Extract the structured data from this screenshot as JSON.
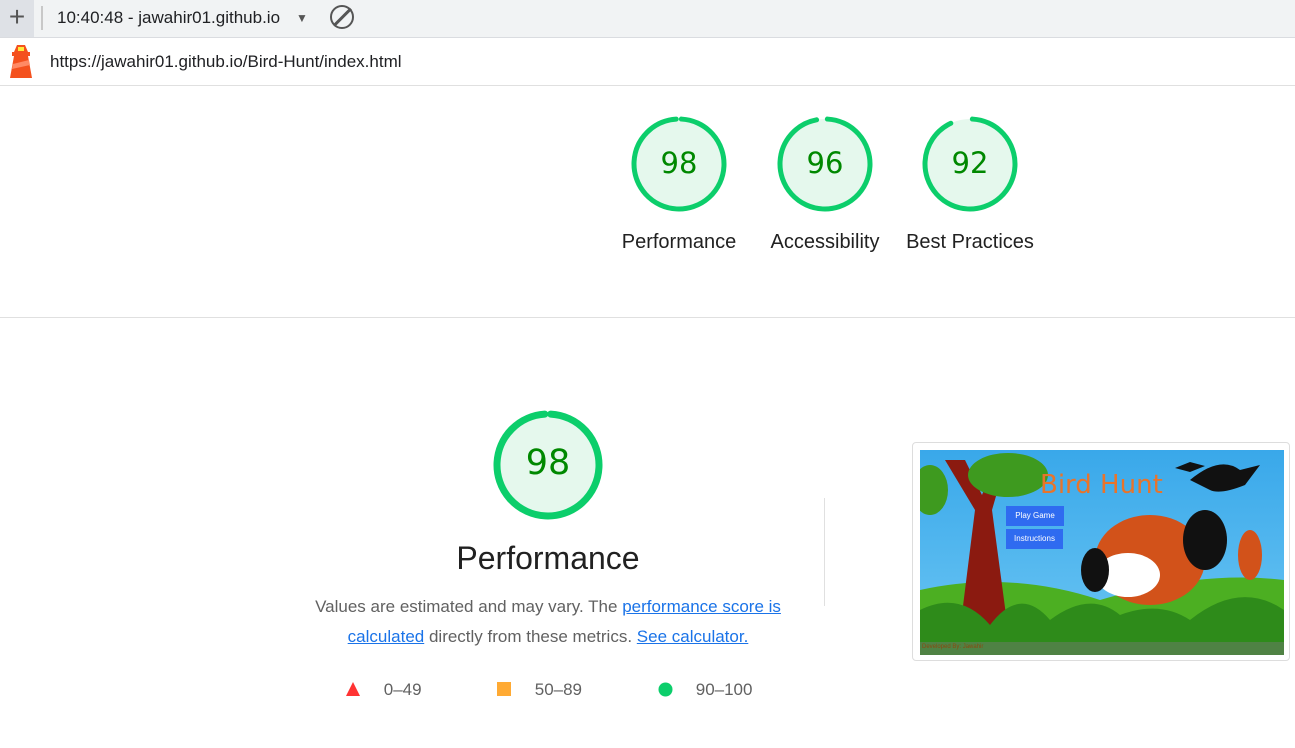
{
  "toolbar": {
    "new_icon": "plus-icon",
    "run_title": "10:40:48 - jawahir01.github.io",
    "dropdown_icon": "caret-down-icon",
    "clear_icon": "block-icon"
  },
  "url": {
    "icon": "lighthouse-icon",
    "text": "https://jawahir01.github.io/Bird-Hunt/index.html"
  },
  "scores": [
    {
      "label": "Performance",
      "value": 98
    },
    {
      "label": "Accessibility",
      "value": 96
    },
    {
      "label": "Best Practices",
      "value": 92
    }
  ],
  "performance": {
    "score": 98,
    "title": "Performance",
    "desc_prefix": "Values are estimated and may vary. The ",
    "link1": "performance score is calculated",
    "desc_mid": " directly from these metrics. ",
    "link2": "See calculator."
  },
  "legend": [
    {
      "range": "0–49",
      "color": "#ff3333",
      "shape": "triangle"
    },
    {
      "range": "50–89",
      "color": "#ffaa33",
      "shape": "square"
    },
    {
      "range": "90–100",
      "color": "#0cce6b",
      "shape": "circle"
    }
  ],
  "screenshot": {
    "title": "Bird Hunt",
    "buttons": [
      "Play Game",
      "Instructions"
    ],
    "footer": "Developed By: Jawahir"
  },
  "colors": {
    "pass": "#0cce6b",
    "pass_text": "#008800",
    "pass_fill": "#e5f8ed"
  }
}
